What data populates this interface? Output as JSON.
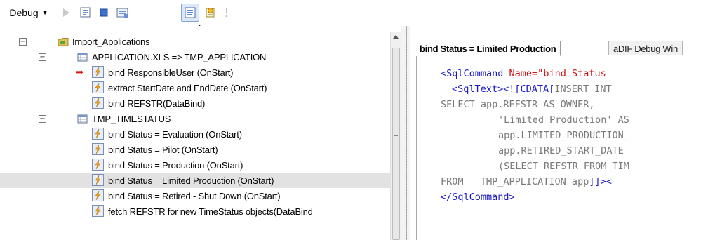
{
  "toolbar": {
    "debug_label": "Debug",
    "buttons": [
      {
        "name": "play-icon"
      },
      {
        "name": "step-into-icon"
      },
      {
        "name": "stop-icon"
      },
      {
        "name": "breakpoints-icon"
      },
      {
        "name": "debug-window-icon",
        "active": true
      },
      {
        "name": "watch-icon"
      },
      {
        "name": "exclamation-icon"
      }
    ]
  },
  "tree": {
    "rows": [
      {
        "label": "Import_Applications"
      },
      {
        "label": "APPLICATION.XLS => TMP_APPLICATION"
      },
      {
        "label": "bind ResponsibleUser (OnStart)"
      },
      {
        "label": "extract StartDate and EndDate (OnStart)"
      },
      {
        "label": "bind REFSTR(DataBind)"
      },
      {
        "label": "TMP_TIMESTATUS"
      },
      {
        "label": "bind Status = Evaluation (OnStart)"
      },
      {
        "label": "bind Status = Pilot (OnStart)"
      },
      {
        "label": "bind Status = Production (OnStart)"
      },
      {
        "label": "bind Status = Limited Production (OnStart)"
      },
      {
        "label": "bind Status = Retired - Shut Down (OnStart)"
      },
      {
        "label": "fetch REFSTR for new TimeStatus objects(DataBind"
      }
    ]
  },
  "editor": {
    "tabs": [
      {
        "label": "bind Status = Limited Production",
        "active": true
      },
      {
        "label": "aDIF Debug Win",
        "active": false
      }
    ],
    "code": {
      "l1_tag": "<SqlCommand ",
      "l1_attr": "Name=\"bind Status",
      "l2_tag": "<SqlText><![CDATA[",
      "l2_sql": "INSERT INT",
      "l3": "SELECT app.REFSTR AS OWNER,",
      "l4": "'Limited Production' AS",
      "l5": "app.LIMITED_PRODUCTION_",
      "l6": "app.RETIRED_START_DATE",
      "l7": "(SELECT REFSTR FROM TIM",
      "l8_sql": "FROM   TMP_APPLICATION app",
      "l8_tag": "]]><",
      "l9_tag": "</SqlCommand>"
    }
  },
  "colors": {
    "xml_tag": "#1a1ac8",
    "xml_attr": "#d01010",
    "sql_text": "#7a7a7a",
    "selection": "#e2e2e2"
  }
}
